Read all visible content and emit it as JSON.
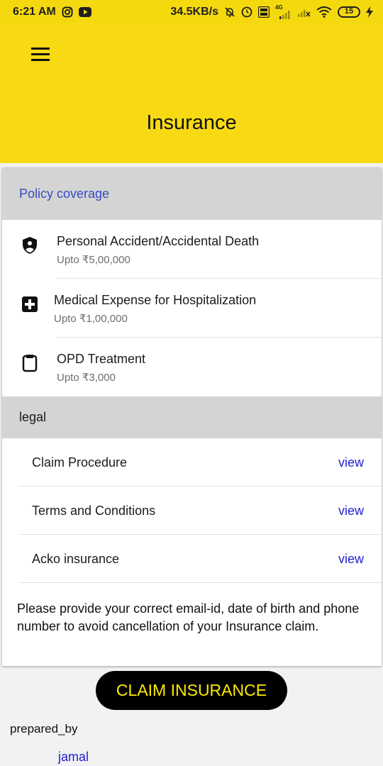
{
  "status_bar": {
    "time": "6:21 AM",
    "net_speed": "34.5KB/s",
    "network_type": "4G",
    "battery_level": "15",
    "icons": [
      "instagram-icon",
      "youtube-icon",
      "alarm-off-icon",
      "clock-icon",
      "volte-icon",
      "signal-icon",
      "signal-weak-icon",
      "wifi-icon",
      "battery-icon",
      "charging-icon"
    ]
  },
  "header": {
    "title": "Insurance",
    "menu_icon": "hamburger-menu-icon"
  },
  "coverage": {
    "section_title": "Policy coverage",
    "items": [
      {
        "title": "Personal Accident/Accidental Death",
        "amount": "Upto ₹5,00,000",
        "icon": "shield-person-icon"
      },
      {
        "title": "Medical Expense for Hospitalization",
        "amount": "Upto ₹1,00,000",
        "icon": "medical-plus-icon"
      },
      {
        "title": "OPD Treatment",
        "amount": "Upto ₹3,000",
        "icon": "clipboard-icon"
      }
    ]
  },
  "legal": {
    "section_title": "legal",
    "items": [
      {
        "label": "Claim Procedure",
        "action": "view"
      },
      {
        "label": "Terms and Conditions",
        "action": "view"
      },
      {
        "label": "Acko insurance",
        "action": "view"
      }
    ]
  },
  "notice": "Please provide your correct email-id, date of birth and phone number to avoid cancellation of your Insurance claim.",
  "cta": {
    "label": "CLAIM INSURANCE"
  },
  "footer": {
    "prepared_label": "prepared_by",
    "author": "jamal"
  },
  "colors": {
    "header_bg": "#f8da14",
    "accent_link": "#1f1fd0",
    "section_title": "#3949c4",
    "cta_text": "#ffea00"
  }
}
